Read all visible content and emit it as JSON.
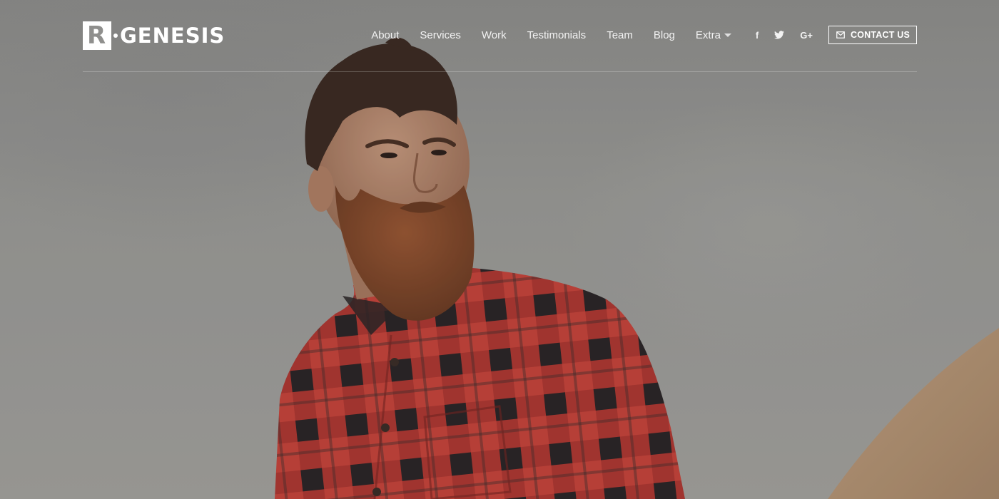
{
  "brand": {
    "logo_letter": "R",
    "name": "GENESIS"
  },
  "nav": {
    "items": [
      {
        "label": "About"
      },
      {
        "label": "Services"
      },
      {
        "label": "Work"
      },
      {
        "label": "Testimonials"
      },
      {
        "label": "Team"
      },
      {
        "label": "Blog"
      },
      {
        "label": "Extra"
      }
    ]
  },
  "social": {
    "facebook_icon": "f",
    "twitter_icon": "twitter-bird-icon",
    "googleplus_icon": "G+"
  },
  "contact": {
    "label": "CONTACT US",
    "icon": "envelope-icon"
  },
  "colors": {
    "text": "#ffffff",
    "sky": "#9a9a96",
    "shirt_red": "#c0392b",
    "shirt_dark": "#2b2324",
    "beard": "#8a4a2a",
    "hair": "#3b2a22"
  }
}
